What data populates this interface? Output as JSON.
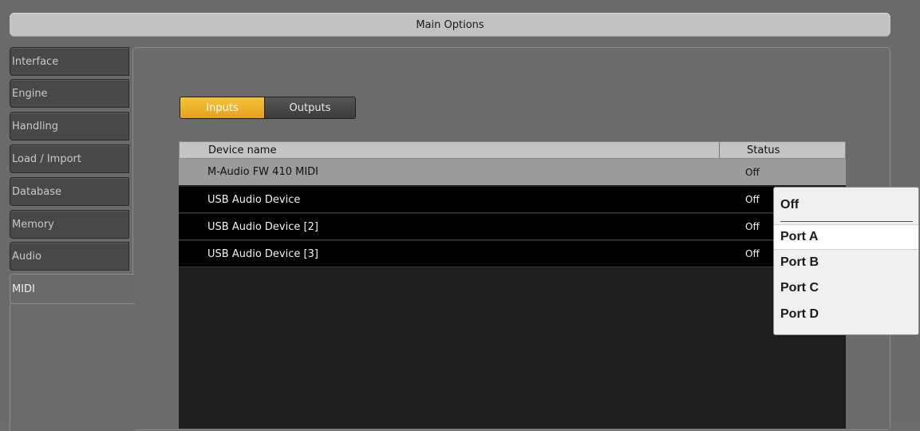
{
  "window": {
    "title": "Main Options"
  },
  "sidebar": {
    "items": [
      {
        "label": "Interface"
      },
      {
        "label": "Engine"
      },
      {
        "label": "Handling"
      },
      {
        "label": "Load / Import"
      },
      {
        "label": "Database"
      },
      {
        "label": "Memory"
      },
      {
        "label": "Audio"
      },
      {
        "label": "MIDI",
        "active": true
      }
    ]
  },
  "toggle": {
    "inputs_label": "Inputs",
    "outputs_label": "Outputs",
    "selected": "Inputs"
  },
  "table": {
    "columns": [
      "Device name",
      "Status"
    ],
    "rows": [
      {
        "name": "M-Audio FW 410 MIDI",
        "status": "Off",
        "selected": true
      },
      {
        "name": "USB Audio Device",
        "status": "Off"
      },
      {
        "name": "USB Audio Device [2]",
        "status": "Off"
      },
      {
        "name": "USB Audio Device [3]",
        "status": "Off"
      }
    ]
  },
  "dropdown": {
    "options": [
      "Off",
      "Port A",
      "Port B",
      "Port C",
      "Port D"
    ],
    "highlighted": "Port A"
  },
  "colors": {
    "accent": "#f0b22c",
    "background": "#6b6b6b",
    "table_bg": "#000000"
  }
}
